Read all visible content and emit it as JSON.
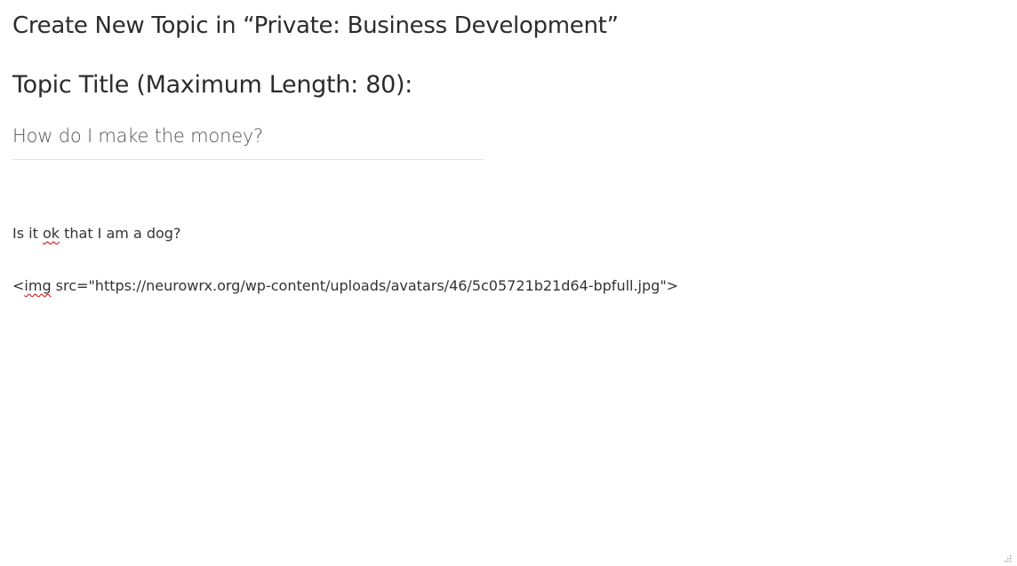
{
  "page": {
    "heading": "Create New Topic in “Private: Business Development”"
  },
  "topic_title": {
    "label": "Topic Title (Maximum Length: 80):",
    "value": "How do I make the money?"
  },
  "editor": {
    "line1_pre": "Is it ",
    "line1_misspelled": "ok",
    "line1_post": " that I am a dog?",
    "line2_pre": "<",
    "line2_misspelled": "img",
    "line2_post": " src=\"https://neurowrx.org/wp-content/uploads/avatars/46/5c05721b21d64-bpfull.jpg\">"
  },
  "icons": {
    "resize_handle": "resize-grip-icon"
  },
  "colors": {
    "spellcheck_underline": "#cc0000",
    "input_border": "#e2e2e2"
  }
}
